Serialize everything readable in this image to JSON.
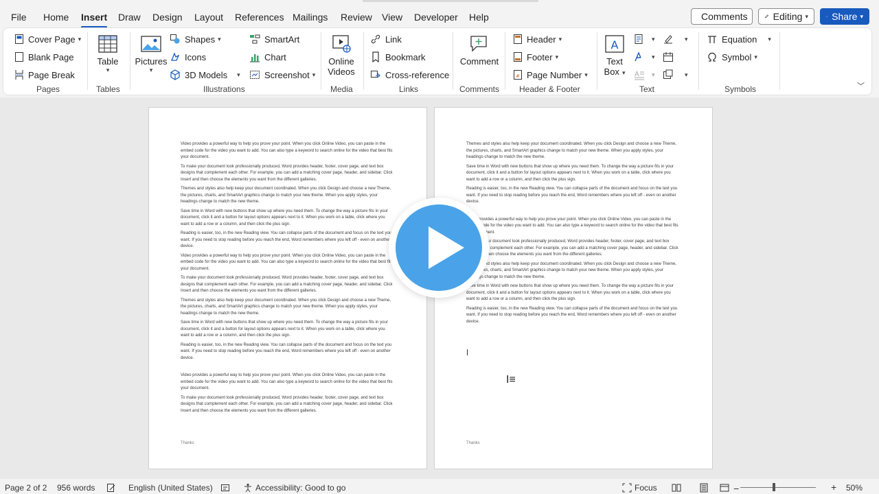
{
  "menu": {
    "tabs": [
      "File",
      "Home",
      "Insert",
      "Draw",
      "Design",
      "Layout",
      "References",
      "Mailings",
      "Review",
      "View",
      "Developer",
      "Help"
    ],
    "active": "Insert",
    "comments_label": "Comments",
    "editing_label": "Editing",
    "share_label": "Share"
  },
  "ribbon": {
    "pages": {
      "label": "Pages",
      "cover_page": "Cover Page",
      "blank_page": "Blank Page",
      "page_break": "Page Break"
    },
    "tables": {
      "label": "Tables",
      "table": "Table"
    },
    "illustrations": {
      "label": "Illustrations",
      "pictures": "Pictures",
      "shapes": "Shapes",
      "icons": "Icons",
      "models_3d": "3D Models",
      "smartart": "SmartArt",
      "chart": "Chart",
      "screenshot": "Screenshot"
    },
    "media": {
      "label": "Media",
      "online_videos_1": "Online",
      "online_videos_2": "Videos"
    },
    "links": {
      "label": "Links",
      "link": "Link",
      "bookmark": "Bookmark",
      "cross_reference": "Cross-reference"
    },
    "comments": {
      "label": "Comments",
      "comment": "Comment"
    },
    "header_footer": {
      "label": "Header & Footer",
      "header": "Header",
      "footer": "Footer",
      "page_number": "Page Number"
    },
    "text": {
      "label": "Text",
      "text_box_1": "Text",
      "text_box_2": "Box"
    },
    "symbols": {
      "label": "Symbols",
      "equation": "Equation",
      "symbol": "Symbol"
    }
  },
  "document": {
    "page1": {
      "paragraphs": [
        "Video provides a powerful way to help you prove your point. When you click Online Video, you can paste in the embed code for the video you want to add. You can also type a keyword to search online for the video that best fits your document.",
        "To make your document look professionally produced, Word provides header, footer, cover page, and text box designs that complement each other. For example, you can add a matching cover page, header, and sidebar. Click Insert and then choose the elements you want from the different galleries.",
        "Themes and styles also help keep your document coordinated. When you click Design and choose a new Theme, the pictures, charts, and SmartArt graphics change to match your new theme. When you apply styles, your headings change to match the new theme.",
        "Save time in Word with new buttons that show up where you need them. To change the way a picture fits in your document, click it and a button for layout options appears next to it. When you work on a table, click where you want to add a row or a column, and then click the plus sign.",
        "Reading is easier, too, in the new Reading view. You can collapse parts of the document and focus on the text you want. If you need to stop reading before you reach the end, Word remembers where you left off - even on another device.",
        "Video provides a powerful way to help you prove your point. When you click Online Video, you can paste in the embed code for the video you want to add. You can also type a keyword to search online for the video that best fits your document.",
        "To make your document look professionally produced, Word provides header, footer, cover page, and text box designs that complement each other. For example, you can add a matching cover page, header, and sidebar. Click Insert and then choose the elements you want from the different galleries.",
        "Themes and styles also help keep your document coordinated. When you click Design and choose a new Theme, the pictures, charts, and SmartArt graphics change to match your new theme. When you apply styles, your headings change to match the new theme.",
        "Save time in Word with new buttons that show up where you need them. To change the way a picture fits in your document, click it and a button for layout options appears next to it. When you work on a table, click where you want to add a row or a column, and then click the plus sign.",
        "Reading is easier, too, in the new Reading view. You can collapse parts of the document and focus on the text you want. If you need to stop reading before you reach the end, Word remembers where you left off - even on another device.",
        "Video provides a powerful way to help you prove your point. When you click Online Video, you can paste in the embed code for the video you want to add. You can also type a keyword to search online for the video that best fits your document.",
        "To make your document look professionally produced, Word provides header, footer, cover page, and text box designs that complement each other. For example, you can add a matching cover page, header, and sidebar. Click Insert and then choose the elements you want from the different galleries."
      ],
      "footer": "Thanks"
    },
    "page2": {
      "paragraphs": [
        "Themes and styles also help keep your document coordinated. When you click Design and choose a new Theme, the pictures, charts, and SmartArt graphics change to match your new theme. When you apply styles, your headings change to match the new theme.",
        "Save time in Word with new buttons that show up where you need them. To change the way a picture fits in your document, click it and a button for layout options appears next to it. When you work on a table, click where you want to add a row or a column, and then click the plus sign.",
        "Reading is easier, too, in the new Reading view. You can collapse parts of the document and focus on the text you want. If you need to stop reading before you reach the end, Word remembers where you left off - even on another device.",
        "Video provides a powerful way to help you prove your point. When you click Online Video, you can paste in the embed code for the video you want to add. You can also type a keyword to search online for the video that best fits your document.",
        "To make your document look professionally produced, Word provides header, footer, cover page, and text box designs that complement each other. For example, you can add a matching cover page, header, and sidebar. Click Insert and then choose the elements you want from the different galleries.",
        "Themes and styles also help keep your document coordinated. When you click Design and choose a new Theme, the pictures, charts, and SmartArt graphics change to match your new theme. When you apply styles, your headings change to match the new theme.",
        "Save time in Word with new buttons that show up where you need them. To change the way a picture fits in your document, click it and a button for layout options appears next to it. When you work on a table, click where you want to add a row or a column, and then click the plus sign.",
        "Reading is easier, too, in the new Reading view. You can collapse parts of the document and focus on the text you want. If you need to stop reading before you reach the end, Word remembers where you left off - even on another device."
      ],
      "footer": "Thanks"
    }
  },
  "status": {
    "page": "Page 2 of 2",
    "words": "956 words",
    "language": "English (United States)",
    "accessibility": "Accessibility: Good to go",
    "focus": "Focus",
    "zoom": "50%"
  },
  "colors": {
    "accent": "#185abd",
    "play": "#4aa3e8"
  }
}
